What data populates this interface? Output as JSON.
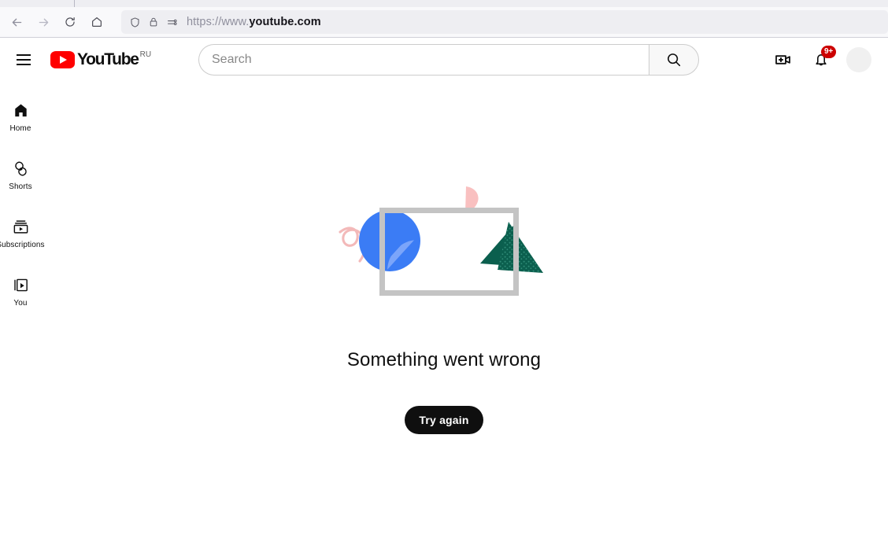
{
  "browser": {
    "back_label": "Back",
    "forward_label": "Forward",
    "reload_label": "Reload",
    "home_label": "Home",
    "url_scheme": "https://www.",
    "url_host": "youtube.com",
    "shield_label": "Tracking protection",
    "lock_label": "Connection secure",
    "permissions_label": "Site permissions"
  },
  "masthead": {
    "menu_label": "Guide menu",
    "logo_text": "YouTube",
    "country_code": "RU",
    "create_label": "Create",
    "notifications_label": "Notifications",
    "notification_count": "9+",
    "avatar_label": "Account"
  },
  "search": {
    "placeholder": "Search",
    "value": "",
    "button_label": "Search"
  },
  "sidebar": {
    "items": [
      {
        "label": "Home",
        "icon": "home-icon"
      },
      {
        "label": "Shorts",
        "icon": "shorts-icon"
      },
      {
        "label": "Subscriptions",
        "icon": "subscriptions-icon"
      },
      {
        "label": "You",
        "icon": "you-icon"
      }
    ]
  },
  "error": {
    "title": "Something went wrong",
    "retry_label": "Try again",
    "illustration_label": "broken-frame-illustration"
  },
  "colors": {
    "brand_red": "#ff0000",
    "badge_red": "#cc0000",
    "button_black": "#0f0f0f",
    "illustration_blue": "#3b7cf5",
    "illustration_blue_light": "#6e9dfa",
    "illustration_teal": "#0b5f4e",
    "illustration_pink": "#f6bdbd",
    "illustration_gray": "#c4c4c4"
  }
}
